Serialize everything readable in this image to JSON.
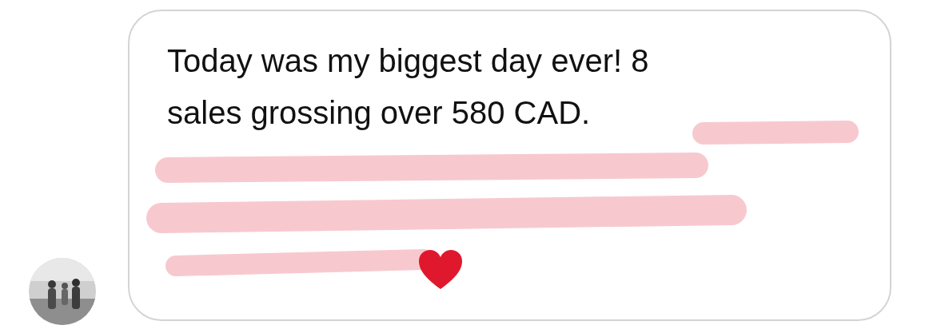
{
  "message": {
    "lines": [
      "Today was my biggest day ever! 8",
      "sales grossing over 580 CAD."
    ]
  }
}
